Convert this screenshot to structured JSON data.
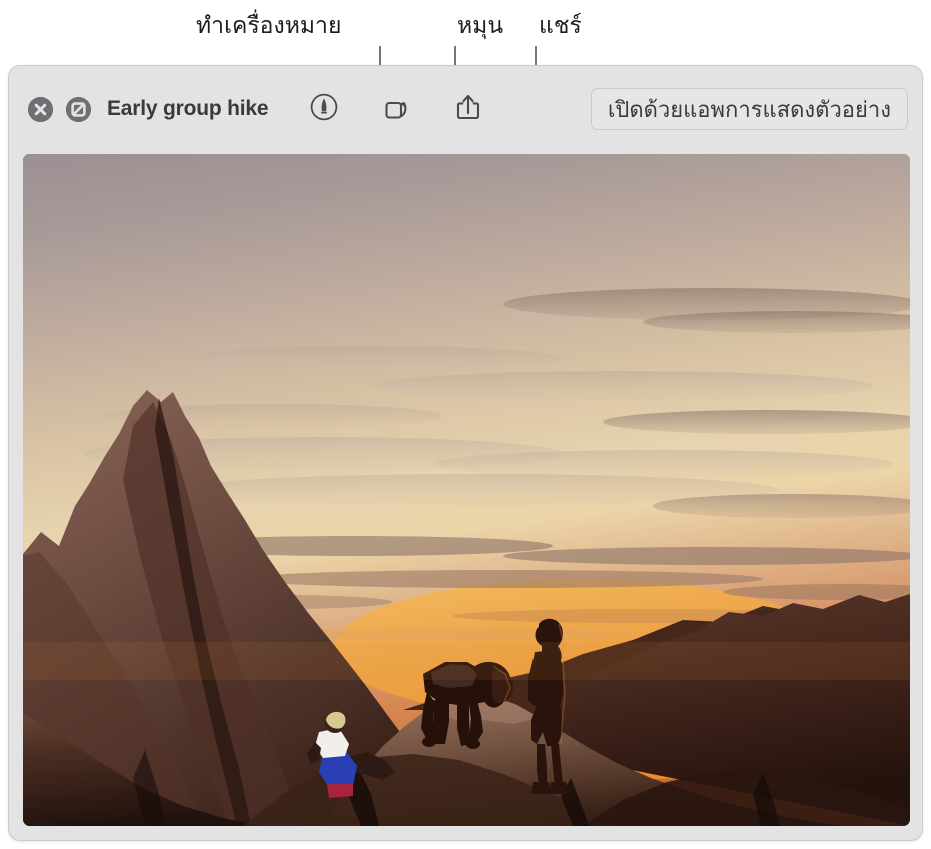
{
  "callouts": [
    {
      "label": "ทำเครื่องหมาย",
      "name": "callout-markup"
    },
    {
      "label": "หมุน",
      "name": "callout-rotate"
    },
    {
      "label": "แชร์",
      "name": "callout-share"
    }
  ],
  "window": {
    "title": "Early group hike",
    "close_icon": "close-circle-icon",
    "markup_off_icon": "no-entry-circle-icon",
    "toolbar": {
      "markup_icon": "markup-pen-icon",
      "rotate_icon": "rotate-left-icon",
      "share_icon": "share-icon",
      "open_with_label": "เปิดด้วยแอพการแสดงตัวอย่าง"
    }
  },
  "photo": {
    "alt": "Three hikers silhouetted on sandstone rocks at sunset",
    "colors": {
      "sky_top": "#9e9296",
      "sky_mid": "#d9c4a8",
      "sky_cream": "#eedcbc",
      "glow_orange": "#f59a23",
      "glow_deep": "#e0691a",
      "rock_light": "#8d6a5c",
      "rock_dark": "#3a221c",
      "rock_darkest": "#1f120e",
      "silhouette": "#2b1510"
    }
  }
}
